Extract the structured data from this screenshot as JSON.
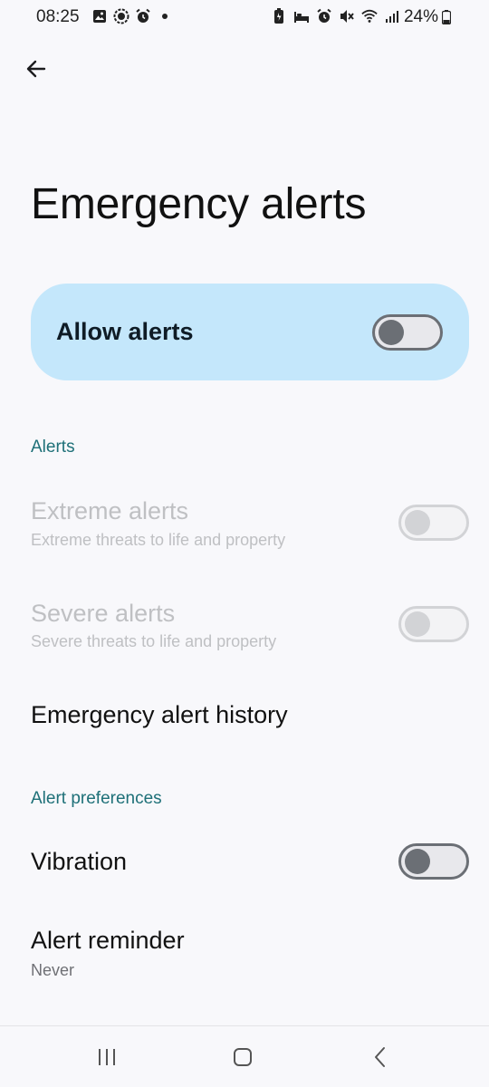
{
  "status_bar": {
    "time": "08:25",
    "battery_percent": "24%",
    "left_icons": [
      "gallery-icon",
      "sync-icon",
      "alarm-icon",
      "dot-icon"
    ],
    "right_icons": [
      "battery-saver-icon",
      "sleep-icon",
      "alarm-icon",
      "mute-icon",
      "wifi-icon",
      "signal-icon"
    ]
  },
  "header": {
    "title": "Emergency alerts"
  },
  "master_switch": {
    "label": "Allow alerts",
    "on": false
  },
  "sections": {
    "alerts_header": "Alerts",
    "preferences_header": "Alert preferences"
  },
  "items": {
    "extreme": {
      "title": "Extreme alerts",
      "subtitle": "Extreme threats to life and property",
      "on": false,
      "enabled": false
    },
    "severe": {
      "title": "Severe alerts",
      "subtitle": "Severe threats to life and property",
      "on": false,
      "enabled": false
    },
    "history": {
      "title": "Emergency alert history"
    },
    "vibration": {
      "title": "Vibration",
      "on": false,
      "enabled": true
    },
    "reminder": {
      "title": "Alert reminder",
      "subtitle": "Never"
    }
  },
  "colors": {
    "accent_section": "#1e7078",
    "master_card_bg": "#c4e7fb",
    "background": "#f8f8fb"
  },
  "navigation_bar": [
    "recents-icon",
    "home-icon",
    "back-icon"
  ]
}
